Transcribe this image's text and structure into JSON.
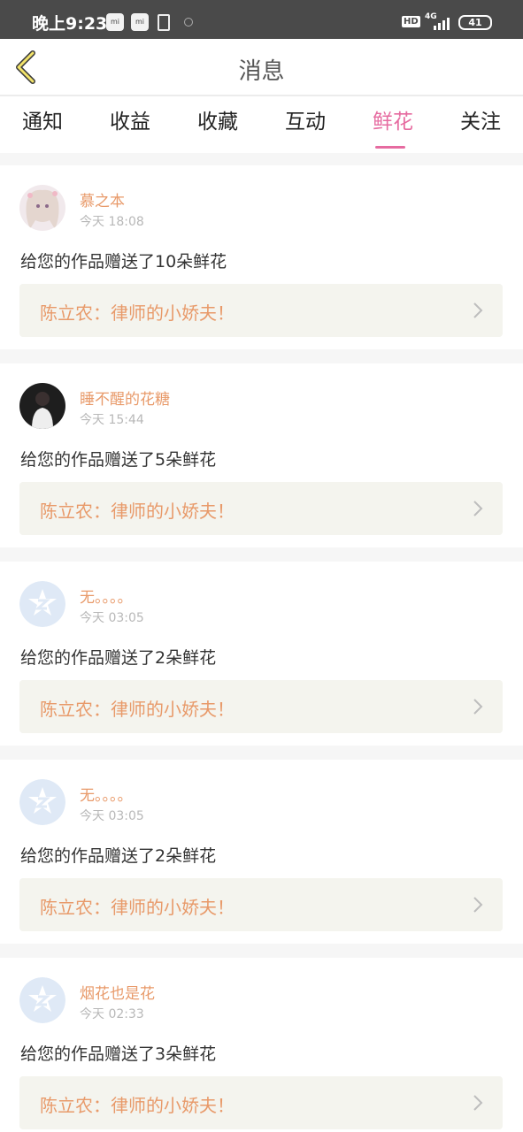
{
  "status_bar": {
    "time": "晚上9:23",
    "hd": "HD",
    "network": "4G",
    "battery": "41"
  },
  "header": {
    "title": "消息"
  },
  "tabs": [
    {
      "label": "通知",
      "active": false
    },
    {
      "label": "收益",
      "active": false
    },
    {
      "label": "收藏",
      "active": false
    },
    {
      "label": "互动",
      "active": false
    },
    {
      "label": "鲜花",
      "active": true
    },
    {
      "label": "关注",
      "active": false
    }
  ],
  "colors": {
    "accent": "#e66ba0",
    "name": "#e89a6a",
    "work_bg": "#f4f4ee"
  },
  "messages": [
    {
      "user": "慕之本",
      "time": "今天 18:08",
      "text": "给您的作品赠送了10朵鲜花",
      "work": "陈立农：律师的小娇夫！",
      "avatar": "anime-avatar"
    },
    {
      "user": "睡不醒的花糖",
      "time": "今天 15:44",
      "text": "给您的作品赠送了5朵鲜花",
      "work": "陈立农：律师的小娇夫！",
      "avatar": "photo-avatar"
    },
    {
      "user": "无。。。。",
      "time": "今天 03:05",
      "text": "给您的作品赠送了2朵鲜花",
      "work": "陈立农：律师的小娇夫！",
      "avatar": "default-avatar"
    },
    {
      "user": "无。。。。",
      "time": "今天 03:05",
      "text": "给您的作品赠送了2朵鲜花",
      "work": "陈立农：律师的小娇夫！",
      "avatar": "default-avatar"
    },
    {
      "user": "烟花也是花",
      "time": "今天 02:33",
      "text": "给您的作品赠送了3朵鲜花",
      "work": "陈立农：律师的小娇夫！",
      "avatar": "default-avatar"
    }
  ]
}
